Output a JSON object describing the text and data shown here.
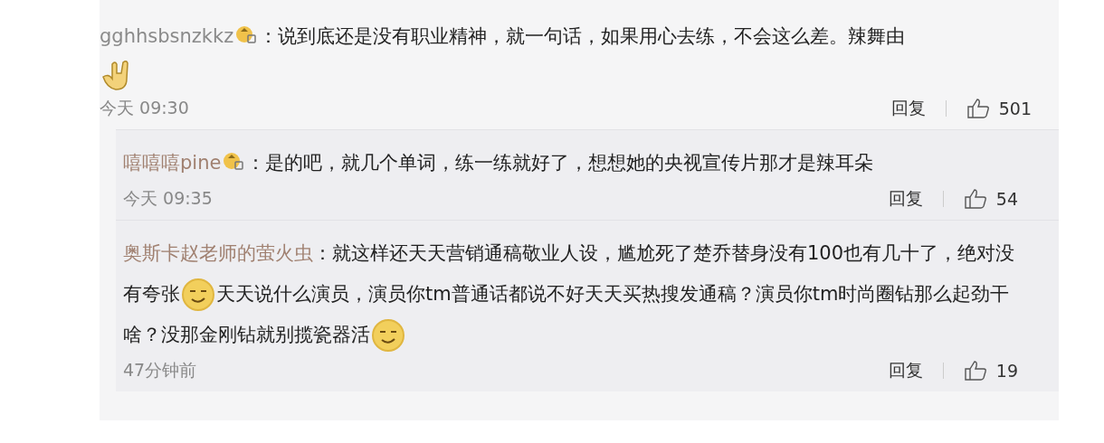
{
  "comments": [
    {
      "kind": "main",
      "username": "gghhsbsnzkkz",
      "badge": true,
      "content": [
        {
          "kind": "text",
          "text": "：说到底还是没有职业精神，就一句话，如果用心去练，不会这么差。辣舞由"
        },
        {
          "kind": "hand"
        }
      ],
      "time": "今天 09:30",
      "reply_label": "回复",
      "likes": "501"
    },
    {
      "kind": "reply",
      "username": "嘻嘻嘻pine",
      "badge": true,
      "content": [
        {
          "kind": "text",
          "text": "：是的吧，就几个单词，练一练就好了，想想她的央视宣传片那才是辣耳朵"
        }
      ],
      "time": "今天 09:35",
      "reply_label": "回复",
      "likes": "54"
    },
    {
      "kind": "reply",
      "username": "奥斯卡赵老师的萤火虫",
      "badge": false,
      "content": [
        {
          "kind": "text",
          "text": "：就这样还天天营销通稿敬业人设，尴尬死了楚乔替身没有100也有几十了，绝对没有夸张"
        },
        {
          "kind": "face"
        },
        {
          "kind": "text",
          "text": "天天说什么演员，演员你tm普通话都说不好天天买热搜发通稿？演员你tm时尚圈钻那么起劲干啥？没那金刚钻就别揽瓷器活"
        },
        {
          "kind": "face"
        }
      ],
      "time": "47分钟前",
      "reply_label": "回复",
      "likes": "19"
    }
  ]
}
